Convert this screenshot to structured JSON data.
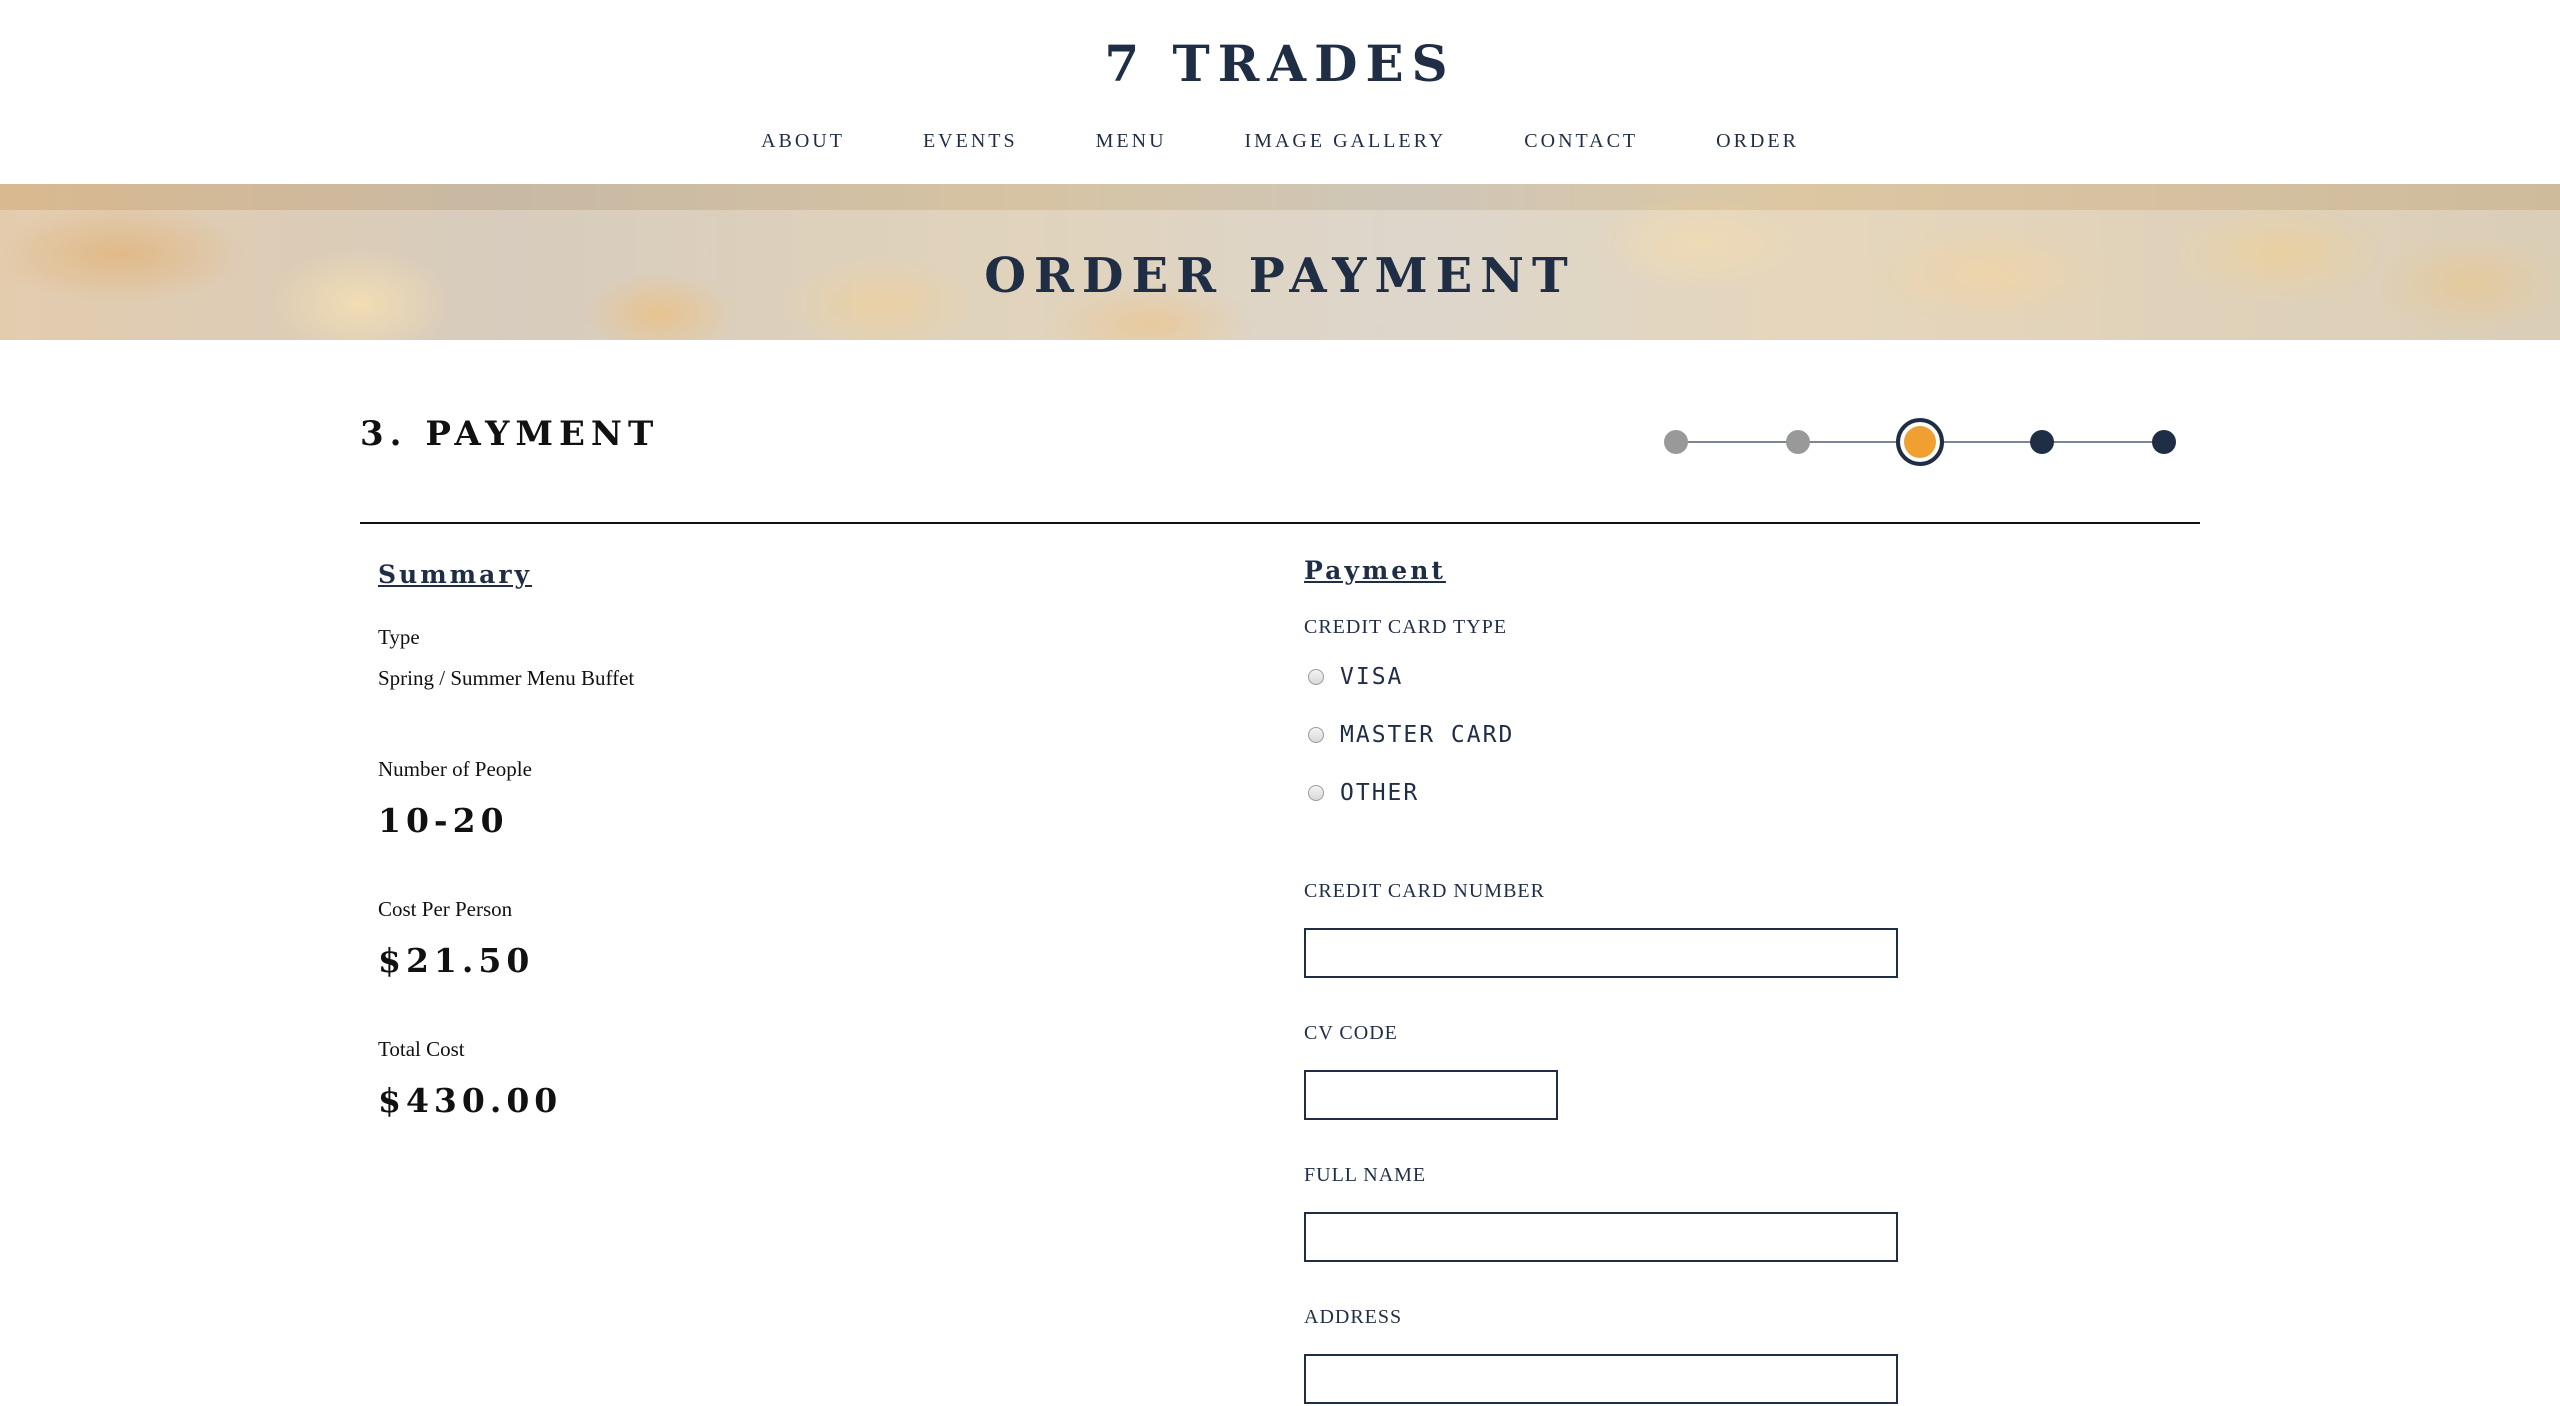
{
  "header": {
    "logo": "7 TRADES",
    "nav": [
      "ABOUT",
      "EVENTS",
      "MENU",
      "IMAGE GALLERY",
      "CONTACT",
      "ORDER"
    ]
  },
  "banner": {
    "title": "ORDER PAYMENT"
  },
  "step": {
    "title": "3. PAYMENT",
    "progress": {
      "total_steps": 5,
      "current_step": 3
    }
  },
  "summary": {
    "heading": "Summary",
    "type_label": "Type",
    "type_value": "Spring / Summer Menu Buffet",
    "people_label": "Number of People",
    "people_value": "10-20",
    "cost_label": "Cost Per Person",
    "cost_value": "$21.50",
    "total_label": "Total Cost",
    "total_value": "$430.00"
  },
  "payment": {
    "heading": "Payment",
    "card_type_label": "CREDIT CARD TYPE",
    "card_types": [
      "VISA",
      "MASTER CARD",
      "OTHER"
    ],
    "card_number_label": "CREDIT CARD NUMBER",
    "card_number_value": "",
    "cv_code_label": "CV CODE",
    "cv_code_value": "",
    "full_name_label": "FULL NAME",
    "full_name_value": "",
    "address_label": "ADDRESS",
    "address_value": ""
  },
  "colors": {
    "navy": "#1f2e45",
    "accent": "#f0a030",
    "completed_step": "#999999"
  }
}
